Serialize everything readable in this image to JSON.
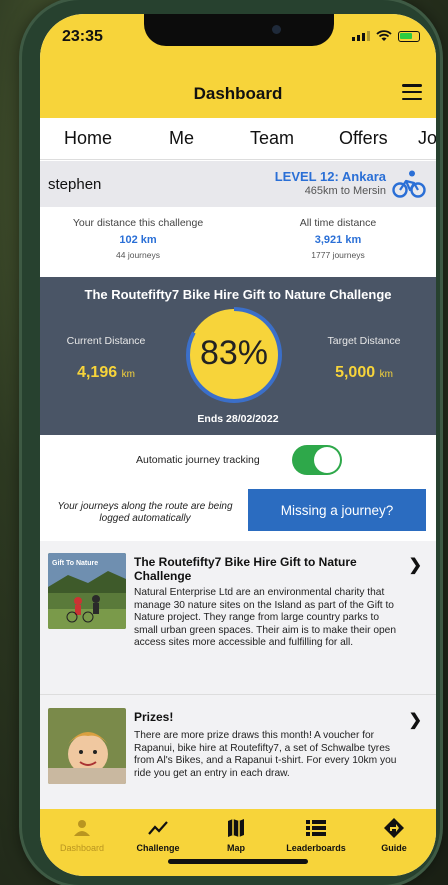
{
  "status_bar": {
    "time": "23:35"
  },
  "header": {
    "title": "Dashboard"
  },
  "tabs": [
    "Home",
    "Me",
    "Team",
    "Offers",
    "Jo"
  ],
  "user": {
    "name": "stephen",
    "level": "LEVEL 12: Ankara",
    "level_sub": "465km to Mersin"
  },
  "stats": {
    "challenge": {
      "label": "Your distance this challenge",
      "value": "102 km",
      "journeys": "44 journeys"
    },
    "all_time": {
      "label": "All time distance",
      "value": "3,921 km",
      "journeys": "1777 journeys"
    }
  },
  "challenge": {
    "title": "The Routefifty7 Bike Hire Gift to Nature Challenge",
    "current_label": "Current Distance",
    "current_value": "4,196",
    "target_label": "Target Distance",
    "target_value": "5,000",
    "unit": "km",
    "percent_text": "83%",
    "percent": 0.83,
    "ends": "Ends 28/02/2022"
  },
  "tracking": {
    "label": "Automatic journey tracking",
    "enabled": true
  },
  "logging": {
    "text": "Your journeys along the route are being logged automatically",
    "button": "Missing a journey?"
  },
  "news": [
    {
      "title": "The Routefifty7 Bike Hire Gift to Nature Challenge",
      "thumb_caption": "Gift To Nature",
      "body": "Natural Enterprise Ltd are an environmental charity that manage 30 nature sites on the Island as part of the Gift to Nature project. They range from large country parks to small urban green spaces. Their aim is to make their open access sites more accessible and fulfilling for all."
    },
    {
      "title": "Prizes!",
      "body": "There are more prize draws this month! A voucher for Rapanui, bike hire at Routefifty7, a set of Schwalbe tyres from Al's Bikes, and a Rapanui t-shirt. For every 10km you ride you get an entry in each draw."
    }
  ],
  "tabbar": [
    "Dashboard",
    "Challenge",
    "Map",
    "Leaderboards",
    "Guide"
  ],
  "colors": {
    "accent_yellow": "#f7d43a",
    "link_blue": "#2a6fd6",
    "challenge_bg": "#4a5566",
    "toggle_green": "#2ea84a",
    "button_blue": "#2b6cc0"
  }
}
